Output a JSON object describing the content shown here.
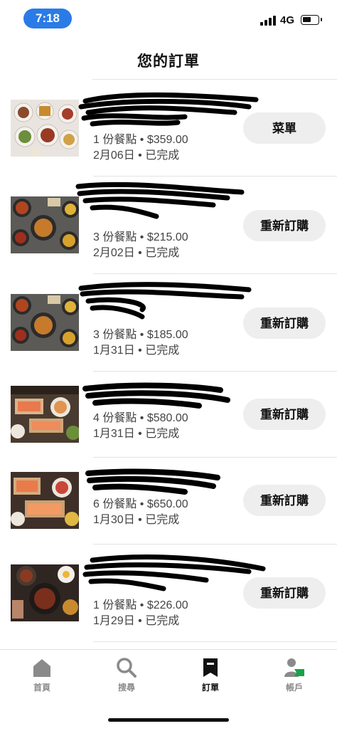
{
  "status": {
    "time": "7:18",
    "network": "4G"
  },
  "header": {
    "title": "您的訂單"
  },
  "orders": [
    {
      "summary": "1 份餐點 • $359.00",
      "date_status": "2月06日 • 已完成",
      "action": "菜單"
    },
    {
      "summary": "3 份餐點 • $215.00",
      "date_status": "2月02日 • 已完成",
      "action": "重新訂購"
    },
    {
      "summary": "3 份餐點 • $185.00",
      "date_status": "1月31日 • 已完成",
      "action": "重新訂購"
    },
    {
      "summary": "4 份餐點 • $580.00",
      "date_status": "1月31日 • 已完成",
      "action": "重新訂購"
    },
    {
      "summary": "6 份餐點 • $650.00",
      "date_status": "1月30日 • 已完成",
      "action": "重新訂購"
    },
    {
      "summary": "1 份餐點 • $226.00",
      "date_status": "1月29日 • 已完成",
      "action": "重新訂購"
    }
  ],
  "tabbar": {
    "home": "首頁",
    "search": "搜尋",
    "orders": "訂單",
    "account": "帳戶"
  },
  "colors": {
    "accent": "#2a7be6",
    "account_badge": "#16a34a"
  }
}
